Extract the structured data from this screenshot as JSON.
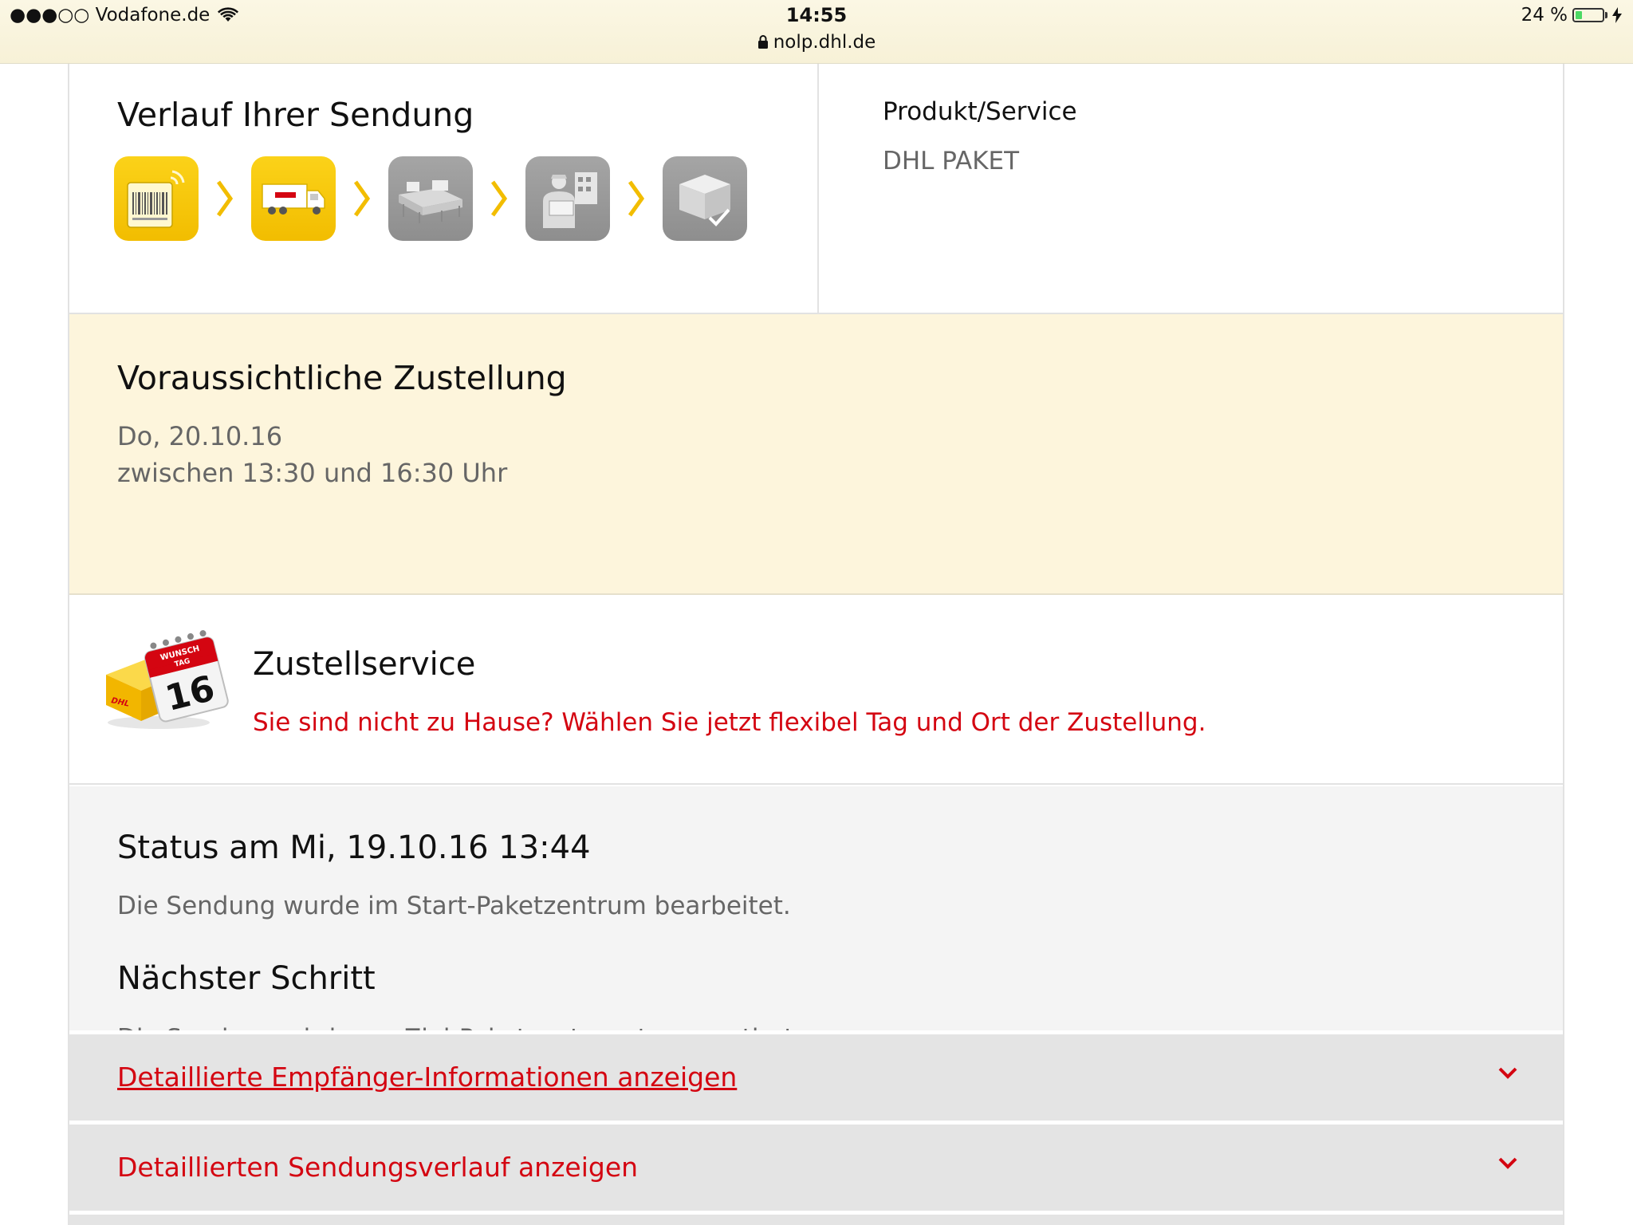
{
  "statusbar": {
    "carrier": "●●●○○ Vodafone.de",
    "time": "14:55",
    "url": "nolp.dhl.de",
    "battery": "24 %",
    "battery_level": 0.24
  },
  "verlauf": {
    "title": "Verlauf Ihrer Sendung",
    "steps": [
      {
        "icon": "barcode-scan-icon",
        "state": "done"
      },
      {
        "icon": "dhl-truck-icon",
        "state": "done"
      },
      {
        "icon": "conveyor-icon",
        "state": "pending"
      },
      {
        "icon": "courier-delivery-icon",
        "state": "pending"
      },
      {
        "icon": "parcel-delivered-icon",
        "state": "pending"
      }
    ]
  },
  "produkt": {
    "label": "Produkt/Service",
    "value": "DHL PAKET"
  },
  "zustellung": {
    "title": "Voraussichtliche Zustellung",
    "date": "Do, 20.10.16",
    "window": "zwischen 13:30 und 16:30 Uhr"
  },
  "service": {
    "title": "Zustellservice",
    "link": "Sie sind nicht zu Hause? Wählen Sie jetzt flexibel Tag und Ort der Zustellung.",
    "calendar_day": "16",
    "calendar_label_1": "WUNSCH",
    "calendar_label_2": "TAG",
    "box_logo": "DHL"
  },
  "status": {
    "title": "Status am Mi, 19.10.16 13:44",
    "text": "Die Sendung wurde im Start-Paketzentrum bearbeitet.",
    "next_title": "Nächster Schritt",
    "next_text": "Die Sendung wird zum Ziel-Paketzentrum transportiert."
  },
  "accordion": [
    {
      "label": "Detaillierte Empfänger-Informationen anzeigen"
    },
    {
      "label": "Detaillierten Sendungsverlauf anzeigen"
    }
  ],
  "colors": {
    "dhl_red": "#d40511",
    "dhl_yellow": "#fbd219",
    "estimate_bg": "#fdf5dc",
    "status_bg": "#f4f4f4"
  }
}
